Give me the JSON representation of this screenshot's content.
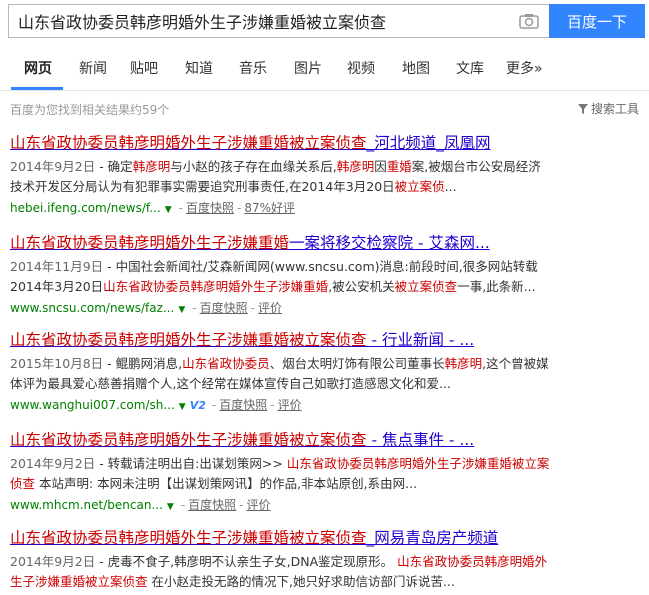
{
  "search": {
    "query": "山东省政协委员韩彦明婚外生子涉嫌重婚被立案侦查",
    "button_label": "百度一下"
  },
  "tabs": [
    {
      "label": "网页"
    },
    {
      "label": "新闻"
    },
    {
      "label": "贴吧"
    },
    {
      "label": "知道"
    },
    {
      "label": "音乐"
    },
    {
      "label": "图片"
    },
    {
      "label": "视频"
    },
    {
      "label": "地图"
    },
    {
      "label": "文库"
    },
    {
      "label": "更多»"
    }
  ],
  "result_count": "百度为您找到相关结果约59个",
  "tools_label": "搜索工具",
  "results": [
    {
      "title_em": "山东省政协委员韩彦明婚外生子涉嫌重婚被立案侦查",
      "title_rest": "_河北频道_凤凰网",
      "date": "2014年9月2日",
      "abstract_parts": [
        " - 确定",
        "韩彦明",
        "与小赵的孩子存在血缘关系后,",
        "韩彦明",
        "因",
        "重婚",
        "案,被烟台市公安局经济技术开发区分局认为有犯罪事实需要追究刑事责任,在2014年3月20日",
        "被立案侦",
        "..."
      ],
      "url": "hebei.ifeng.com/news/f...",
      "links": [
        "百度快照",
        "87%好评"
      ]
    },
    {
      "title_em": "山东省政协委员韩彦明婚外生子涉嫌重婚",
      "title_rest": "一案将移交检察院 - 艾森网...",
      "date": "2014年11月9日",
      "abstract_parts": [
        " - 中国社会新闻社/艾森新闻网(www.sncsu.com)消息:前段时间,很多网站转载2014年3月20日",
        "山东省政协委员韩彦明婚外生子涉嫌重婚",
        ",被公安机关",
        "被立案侦查",
        "一事,此条新..."
      ],
      "url": "www.sncsu.com/news/faz...",
      "links": [
        "百度快照",
        "评价"
      ]
    },
    {
      "title_em": "山东省政协委员韩彦明婚外生子涉嫌重婚被立案侦查",
      "title_rest": " - 行业新闻 - ...",
      "date": "2015年10月8日",
      "abstract_parts": [
        " - 鲲鹏网消息,",
        "山东省政协委员",
        "、烟台太明灯饰有限公司董事长",
        "韩彦明",
        ",这个曾被媒体评为最具爱心慈善捐赠个人,这个经常在媒体宣传自己如歌打造感恩文化和爱..."
      ],
      "url": "www.wanghui007.com/sh...",
      "badge": "V2",
      "links": [
        "百度快照",
        "评价"
      ]
    },
    {
      "title_em": "山东省政协委员韩彦明婚外生子涉嫌重婚被立案侦查",
      "title_rest": " - 焦点事件 - ...",
      "date": "2014年9月2日",
      "abstract_parts": [
        " - 转载请注明出自:出谋划策网>> ",
        "山东省政协委员韩彦明婚外生子涉嫌重婚被立案侦查",
        " 本站声明: 本网未注明【出谋划策网讯】的作品,非本站原创,系由网..."
      ],
      "url": "www.mhcm.net/bencan...",
      "links": [
        "百度快照",
        "评价"
      ]
    },
    {
      "title_em": "山东省政协委员韩彦明婚外生子涉嫌重婚被立案侦查",
      "title_rest": "_网易青岛房产频道",
      "date": "2014年9月2日",
      "abstract_parts": [
        " - 虎毒不食子,韩彦明不认亲生子女,DNA鉴定现原形。 ",
        "山东省政协委员韩彦明婚外生子涉嫌重婚被立案侦查",
        " 在小赵走投无路的情况下,她只好求助信访部门诉说苦..."
      ],
      "url": "",
      "links": []
    }
  ],
  "colors": {
    "accent": "#3385ff",
    "title_link": "#2000cc",
    "highlight": "#cc0000",
    "url": "#008000"
  }
}
